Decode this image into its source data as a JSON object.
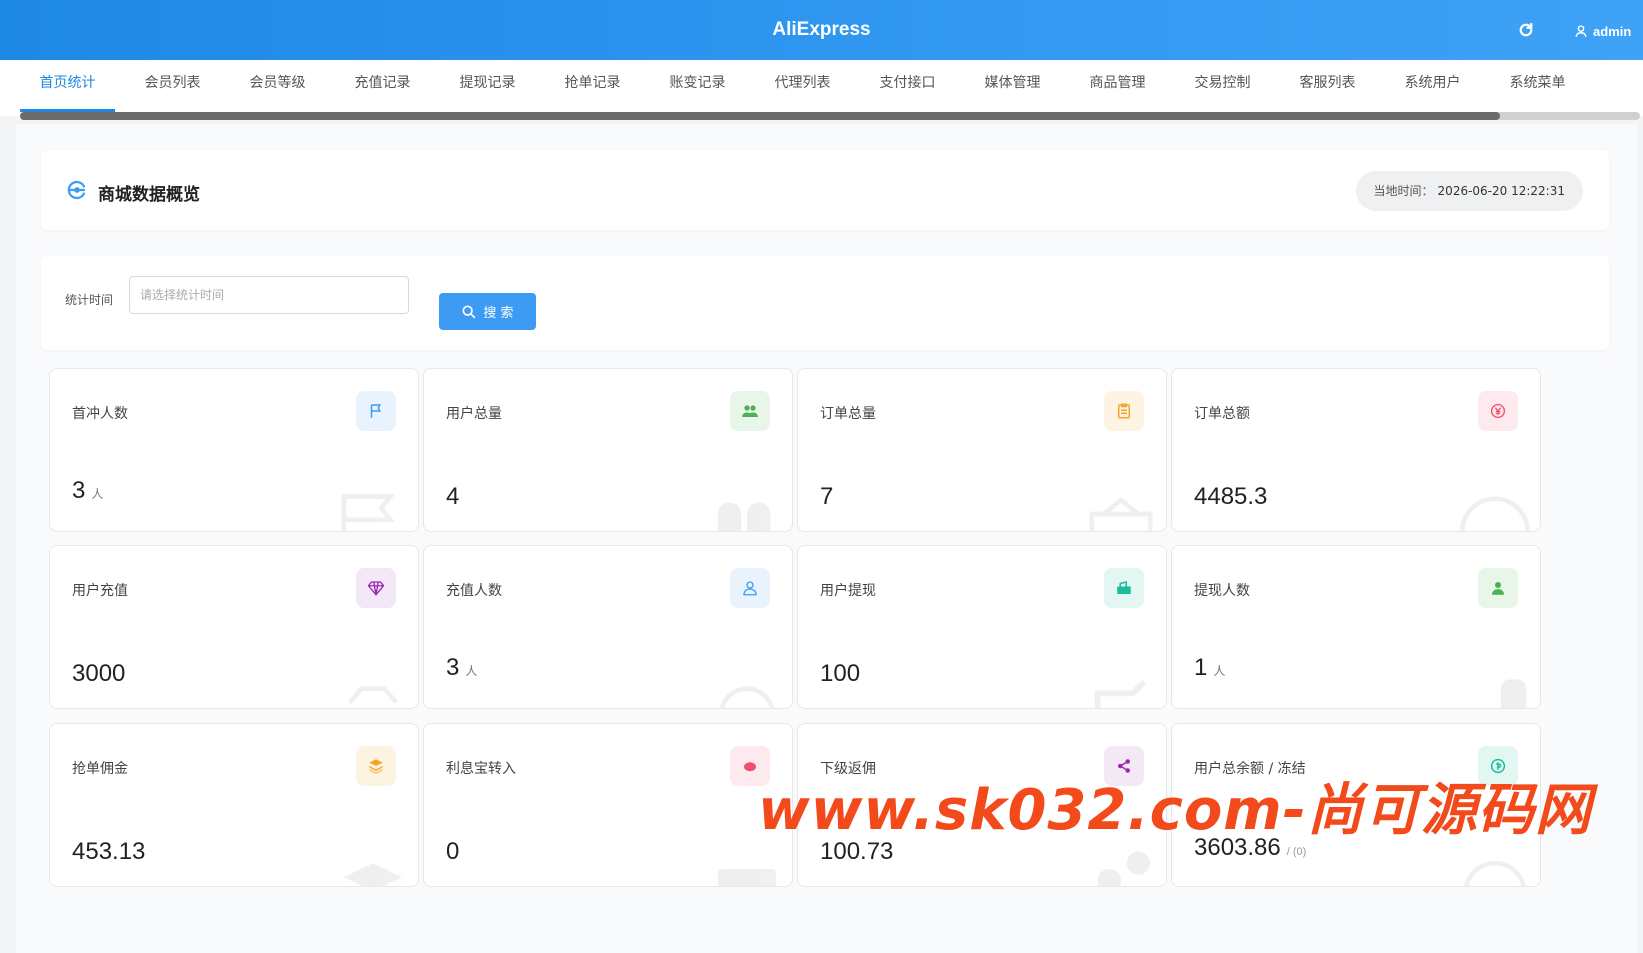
{
  "header": {
    "app_title": "AliExpress",
    "user_label": "admin"
  },
  "nav": {
    "tabs": [
      {
        "label": "首页统计",
        "active": true
      },
      {
        "label": "会员列表"
      },
      {
        "label": "会员等级"
      },
      {
        "label": "充值记录"
      },
      {
        "label": "提现记录"
      },
      {
        "label": "抢单记录"
      },
      {
        "label": "账变记录"
      },
      {
        "label": "代理列表"
      },
      {
        "label": "支付接口"
      },
      {
        "label": "媒体管理"
      },
      {
        "label": "商品管理"
      },
      {
        "label": "交易控制"
      },
      {
        "label": "客服列表"
      },
      {
        "label": "系统用户"
      },
      {
        "label": "系统菜单"
      }
    ]
  },
  "overview": {
    "title": "商城数据概览",
    "time_label": "当地时间：",
    "time_value": "2026-06-20 12:22:31"
  },
  "filter": {
    "label": "统计时间",
    "placeholder": "请选择统计时间",
    "search_label": "搜 索"
  },
  "stats": {
    "cards": [
      {
        "label": "首冲人数",
        "value": "3",
        "unit": "人",
        "icon": "flag-icon",
        "color": "#3d9bf4"
      },
      {
        "label": "用户总量",
        "value": "4",
        "unit": "",
        "icon": "users-icon",
        "color": "#4caf50"
      },
      {
        "label": "订单总量",
        "value": "7",
        "unit": "",
        "icon": "clipboard-icon",
        "color": "#f5a623"
      },
      {
        "label": "订单总额",
        "value": "4485.3",
        "unit": "",
        "icon": "yen-icon",
        "color": "#f0506e"
      },
      {
        "label": "用户充值",
        "value": "3000",
        "unit": "",
        "icon": "diamond-icon",
        "color": "#9c27b0"
      },
      {
        "label": "充值人数",
        "value": "3",
        "unit": "人",
        "icon": "user-outline-icon",
        "color": "#3d9bf4"
      },
      {
        "label": "用户提现",
        "value": "100",
        "unit": "",
        "icon": "wallet-icon",
        "color": "#1abc9c"
      },
      {
        "label": "提现人数",
        "value": "1",
        "unit": "人",
        "icon": "user-icon",
        "color": "#4caf50"
      },
      {
        "label": "抢单佣金",
        "value": "453.13",
        "unit": "",
        "icon": "layers-icon",
        "color": "#f5a623"
      },
      {
        "label": "利息宝转入",
        "value": "0",
        "unit": "",
        "icon": "piggy-icon",
        "color": "#f0506e"
      },
      {
        "label": "下级返佣",
        "value": "100.73",
        "unit": "",
        "icon": "share-icon",
        "color": "#9c27b0"
      },
      {
        "label": "用户总余额 / 冻结",
        "value": "3603.86",
        "unit": "",
        "sub": "/ (0)",
        "icon": "coin-icon",
        "color": "#1abc9c"
      }
    ]
  },
  "watermark": "www.sk032.com-尚可源码网"
}
